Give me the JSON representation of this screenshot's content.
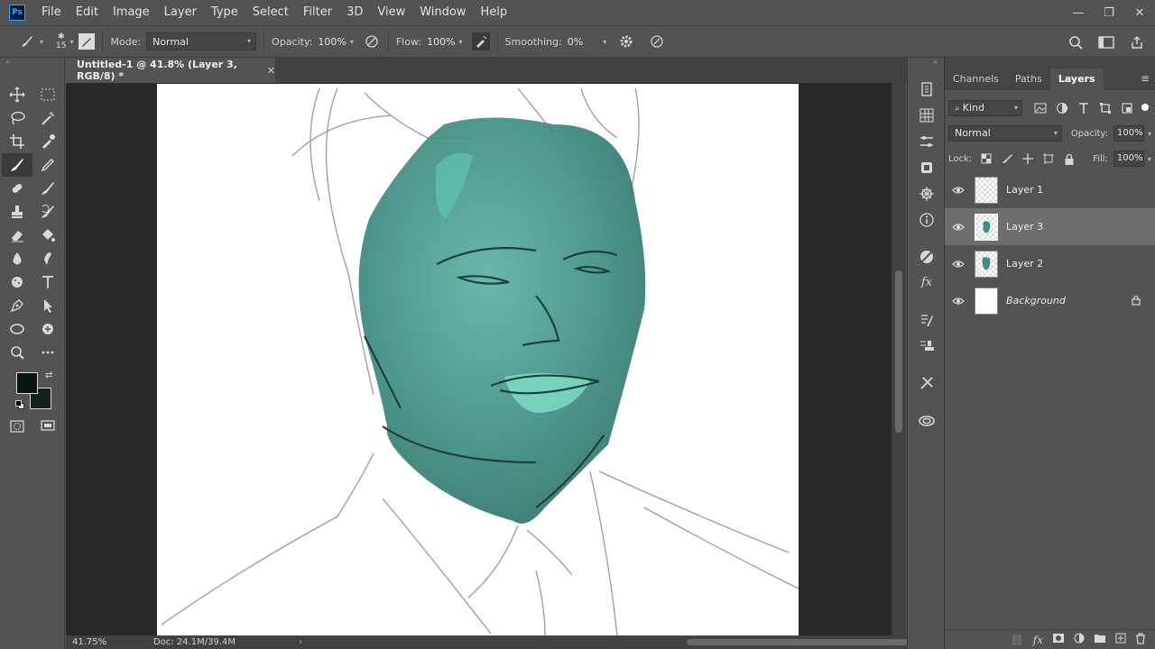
{
  "app": {
    "logo_text": "Ps"
  },
  "menu": [
    "File",
    "Edit",
    "Image",
    "Layer",
    "Type",
    "Select",
    "Filter",
    "3D",
    "View",
    "Window",
    "Help"
  ],
  "options": {
    "brush_size": "15",
    "mode_label": "Mode:",
    "mode_value": "Normal",
    "opacity_label": "Opacity:",
    "opacity_value": "100%",
    "flow_label": "Flow:",
    "flow_value": "100%",
    "smoothing_label": "Smoothing:",
    "smoothing_value": "0%"
  },
  "document": {
    "tab_title": "Untitled-1 @ 41.8% (Layer 3, RGB/8) *",
    "zoom": "41.75%",
    "doc_info": "Doc: 24.1M/39.4M"
  },
  "colors": {
    "foreground": "#0a1412",
    "background": "#15211f",
    "skin": "#3f8f84"
  },
  "panel": {
    "tabs": [
      "Channels",
      "Paths",
      "Layers"
    ],
    "active_tab": "Layers",
    "filter_label": "Kind",
    "blend_mode": "Normal",
    "opacity_label": "Opacity:",
    "opacity_value": "100%",
    "lock_label": "Lock:",
    "fill_label": "Fill:",
    "fill_value": "100%",
    "layers": [
      {
        "name": "Layer 1",
        "selected": false
      },
      {
        "name": "Layer 3",
        "selected": true
      },
      {
        "name": "Layer 2",
        "selected": false
      },
      {
        "name": "Background",
        "selected": false,
        "locked": true
      }
    ]
  }
}
